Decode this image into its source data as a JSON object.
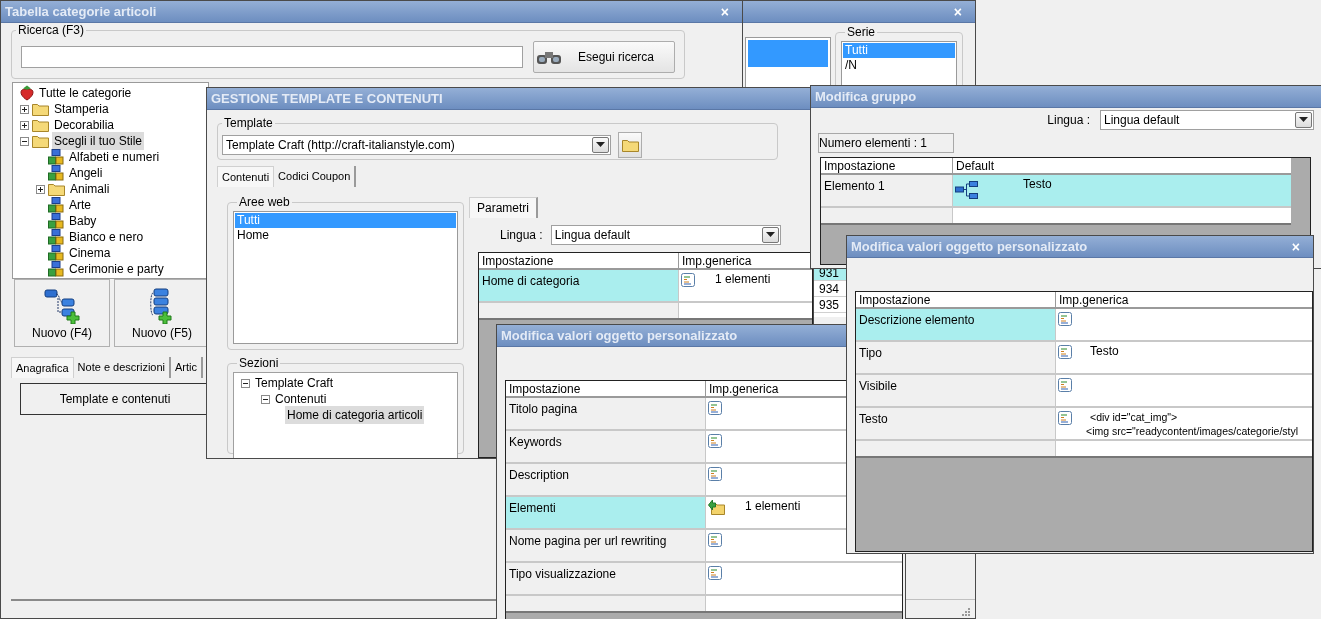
{
  "back_window": {
    "close": "×",
    "list_rows": [
      {
        "selected": true
      }
    ],
    "serie": {
      "label": "Serie",
      "items": [
        {
          "text": "Tutti",
          "selected": true
        },
        {
          "text": "/N",
          "selected": false
        }
      ]
    },
    "column_cells": [
      {
        "text": "931",
        "selected": true
      },
      {
        "text": "934",
        "selected": false
      },
      {
        "text": "935",
        "selected": false
      }
    ]
  },
  "categories_window": {
    "title": "Tabella categorie articoli",
    "close": "×",
    "search": {
      "label": "Ricerca (F3)",
      "button": "Esegui ricerca"
    },
    "tree": [
      {
        "label": "Tutte le categorie",
        "kind": "root",
        "selected": false,
        "children": [
          {
            "label": "Stamperia",
            "kind": "folder",
            "expanded": false,
            "selected": false
          },
          {
            "label": "Decorabilia",
            "kind": "folder",
            "expanded": false,
            "selected": false
          },
          {
            "label": "Scegli il tuo Stile",
            "kind": "folder",
            "expanded": true,
            "selected": true,
            "children": [
              {
                "label": "Alfabeti e numeri",
                "kind": "category",
                "selected": false
              },
              {
                "label": "Angeli",
                "kind": "category",
                "selected": false
              },
              {
                "label": "Animali",
                "kind": "folder",
                "expanded": false,
                "selected": false
              },
              {
                "label": "Arte",
                "kind": "category",
                "selected": false
              },
              {
                "label": "Baby",
                "kind": "category",
                "selected": false
              },
              {
                "label": "Bianco e nero",
                "kind": "category",
                "selected": false
              },
              {
                "label": "Cinema",
                "kind": "category",
                "selected": false
              },
              {
                "label": "Cerimonie e party",
                "kind": "category",
                "selected": false
              }
            ]
          }
        ]
      }
    ],
    "new_buttons": [
      {
        "label": "Nuovo (F4)",
        "kind": "tree"
      },
      {
        "label": "Nuovo (F5)",
        "kind": "list"
      }
    ],
    "tabs": [
      {
        "label": "Anagrafica",
        "selected": true
      },
      {
        "label": "Note e descrizioni",
        "selected": false
      },
      {
        "label": "Artic",
        "selected": false
      }
    ],
    "action_button": "Template e contenuti"
  },
  "template_window": {
    "title": "GESTIONE TEMPLATE E CONTENUTI",
    "template": {
      "label": "Template",
      "value": "Template Craft (http://craft-italianstyle.com)"
    },
    "tabs": [
      {
        "label": "Contenuti",
        "selected": true
      },
      {
        "label": "Codici Coupon",
        "selected": false
      }
    ],
    "web_areas": {
      "label": "Aree web",
      "items": [
        {
          "text": "Tutti",
          "selected": true
        },
        {
          "text": "Home",
          "selected": false
        }
      ]
    },
    "sections": {
      "label": "Sezioni",
      "tree": [
        {
          "label": "Template Craft",
          "expanded": true,
          "selected": false,
          "children": [
            {
              "label": "Contenuti",
              "expanded": true,
              "selected": false,
              "children": [
                {
                  "label": "Home di categoria articoli",
                  "selected": true
                }
              ]
            }
          ]
        }
      ]
    },
    "parameters_tab": {
      "label": "Parametri",
      "selected": true
    },
    "language": {
      "label": "Lingua :",
      "value": "Lingua default"
    },
    "table": {
      "columns": [
        "Impostazione",
        "Imp.generica"
      ],
      "rows": [
        {
          "setting": "Home di categoria",
          "kind": "text",
          "value": [
            "1 elementi"
          ],
          "selected": true
        }
      ]
    }
  },
  "group_window": {
    "title": "Modifica gruppo",
    "language": {
      "label": "Lingua :",
      "value": "Lingua default"
    },
    "count": "Numero elementi : 1",
    "table": {
      "columns": [
        "Impostazione",
        "Default"
      ],
      "rows": [
        {
          "setting": "Elemento 1",
          "kind": "group",
          "value": [
            "Testo"
          ],
          "selected": true
        }
      ]
    }
  },
  "object_window_left": {
    "title": "Modifica valori oggetto personalizzato",
    "table": {
      "columns": [
        "Impostazione",
        "Imp.generica"
      ],
      "rows": [
        {
          "setting": "Titolo pagina",
          "kind": "text",
          "selected": false
        },
        {
          "setting": "Keywords",
          "kind": "text",
          "selected": false
        },
        {
          "setting": "Description",
          "kind": "text",
          "selected": false
        },
        {
          "setting": "Elementi",
          "kind": "list",
          "value": [
            "1 elementi"
          ],
          "selected": true
        },
        {
          "setting": "Nome pagina per url rewriting",
          "kind": "text",
          "selected": false
        },
        {
          "setting": "Tipo visualizzazione",
          "kind": "text",
          "selected": false
        }
      ]
    }
  },
  "object_window_right": {
    "title": "Modifica valori oggetto personalizzato",
    "close": "×",
    "table": {
      "columns": [
        "Impostazione",
        "Imp.generica"
      ],
      "rows": [
        {
          "setting": "Descrizione elemento",
          "kind": "text",
          "selected": true
        },
        {
          "setting": "Tipo",
          "kind": "text",
          "value": [
            "Testo"
          ],
          "selected": false
        },
        {
          "setting": "Visibile",
          "kind": "text",
          "selected": false
        },
        {
          "setting": "Testo",
          "kind": "text",
          "value": [
            "<div id=\"cat_img\">",
            "<img src=\"readycontent/images/categorie/styl"
          ],
          "selected": false
        }
      ]
    }
  }
}
